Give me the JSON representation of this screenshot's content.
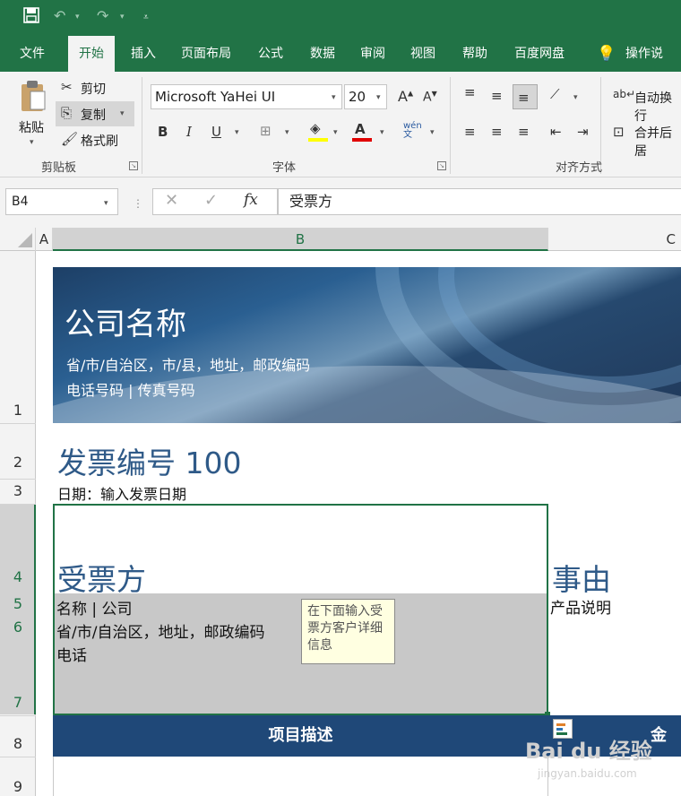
{
  "quick_access": {
    "save_icon": "save-icon",
    "undo_icon": "undo-icon",
    "redo_icon": "redo-icon",
    "customize_icon": "customize-icon"
  },
  "tabs": [
    "文件",
    "开始",
    "插入",
    "页面布局",
    "公式",
    "数据",
    "审阅",
    "视图",
    "帮助",
    "百度网盘",
    "操作说明"
  ],
  "active_tab": "开始",
  "ribbon": {
    "clipboard": {
      "label": "剪贴板",
      "paste": "粘贴",
      "cut": "剪切",
      "copy": "复制",
      "format_painter": "格式刷"
    },
    "font": {
      "label": "字体",
      "name": "Microsoft YaHei UI",
      "size": "20",
      "bold": "B",
      "italic": "I",
      "underline": "U",
      "phonetic": "wén\n文"
    },
    "alignment": {
      "label": "对齐方式",
      "wrap": "自动换行",
      "merge": "合并后居"
    }
  },
  "formula_bar": {
    "name_box": "B4",
    "content": "受票方",
    "fx": "fx"
  },
  "columns": [
    "A",
    "B",
    "C"
  ],
  "rows": [
    "1",
    "2",
    "3",
    "4",
    "5",
    "6",
    "7",
    "8",
    "9"
  ],
  "sheet": {
    "company_name": "公司名称",
    "address": "省/市/自治区，市/县，地址，邮政编码",
    "phone_fax": "电话号码 | 传真号码",
    "invoice_no": "发票编号 100",
    "date": "日期：输入发票日期",
    "bill_to": "受票方",
    "reason": "事由",
    "bill_name": "名称 | 公司",
    "bill_address": "省/市/自治区，地址，邮政编码",
    "bill_phone": "电话",
    "product": "产品说明",
    "tooltip": "在下面输入受票方客户详细信息",
    "header_desc": "项目描述",
    "header_amount": "金额"
  },
  "watermark": {
    "main": "Bai du 经验",
    "sub": "jingyan.baidu.com"
  },
  "colors": {
    "excel_green": "#217346",
    "title_blue": "#2f5a88",
    "header_navy": "#1f4878",
    "selection_grey": "#c8c8c8"
  }
}
